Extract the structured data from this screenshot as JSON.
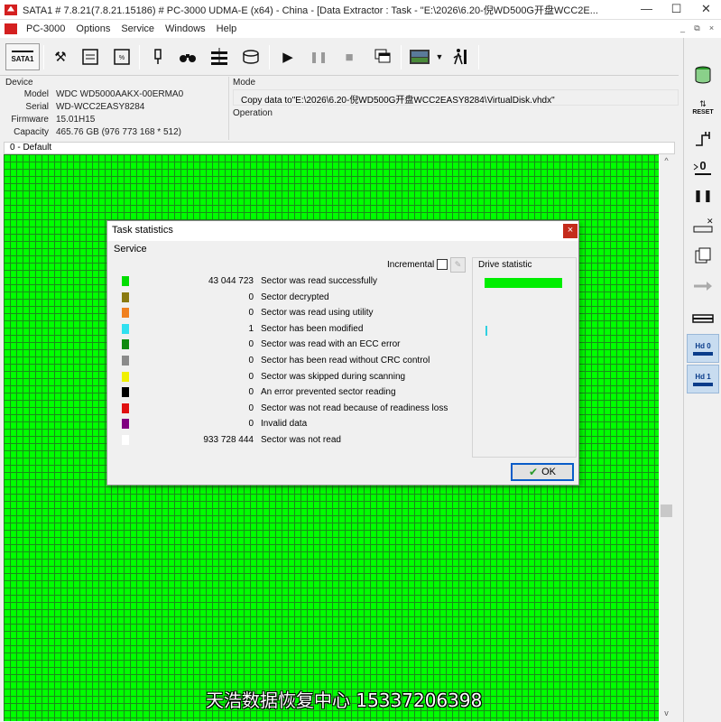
{
  "window": {
    "title": "SATA1 # 7.8.21(7.8.21.15186) # PC-3000 UDMA-E (x64) - China - [Data Extractor : Task - \"E:\\2026\\6.20-倪WD500G开盘WCC2E...",
    "minimize": "—",
    "maximize": "☐",
    "close": "✕"
  },
  "menu": {
    "items": [
      "PC-3000",
      "Options",
      "Service",
      "Windows",
      "Help"
    ],
    "mdi": [
      "_",
      "⧉",
      "×"
    ]
  },
  "toolbar": {
    "sata_label": "SATA1"
  },
  "device": {
    "header": "Device",
    "fields": [
      {
        "key": "Model",
        "value": "WDC WD5000AAKX-00ERMA0"
      },
      {
        "key": "Serial",
        "value": "WD-WCC2EASY8284"
      },
      {
        "key": "Firmware",
        "value": "15.01H15"
      },
      {
        "key": "Capacity",
        "value": "465.76 GB (976 773 168 * 512)"
      }
    ]
  },
  "mode": {
    "header": "Mode",
    "text": "Copy data to\"E:\\2026\\6.20-倪WD500G开盘WCC2EASY8284\\VirtualDisk.vhdx\""
  },
  "operation": {
    "header": "Operation"
  },
  "map": {
    "tab_label": "0 - Default",
    "scroll_up": "^",
    "scroll_down": "v"
  },
  "right_toolbar": {
    "reset_label": "RESET",
    "hd0_label": "Hd 0",
    "hd1_label": "Hd 1"
  },
  "dialog": {
    "title": "Task statistics",
    "close": "×",
    "service_label": "Service",
    "incremental_label": "Incremental",
    "drive_statistic_label": "Drive statistic",
    "ok_label": "OK",
    "stats": [
      {
        "color": "#00dd00",
        "count": "43 044 723",
        "label": "Sector was read successfully"
      },
      {
        "color": "#8a7a10",
        "count": "0",
        "label": "Sector decrypted"
      },
      {
        "color": "#f08020",
        "count": "0",
        "label": "Sector was read using utility"
      },
      {
        "color": "#30e0f0",
        "count": "1",
        "label": "Sector has been modified"
      },
      {
        "color": "#108a10",
        "count": "0",
        "label": "Sector was read with an ECC error"
      },
      {
        "color": "#8a8a8a",
        "count": "0",
        "label": "Sector has been read without CRC control"
      },
      {
        "color": "#f0f000",
        "count": "0",
        "label": "Sector was skipped during scanning"
      },
      {
        "color": "#000000",
        "count": "0",
        "label": "An error prevented sector reading"
      },
      {
        "color": "#e01010",
        "count": "0",
        "label": "Sector was not read because of readiness loss"
      },
      {
        "color": "#800080",
        "count": "0",
        "label": "Invalid data"
      },
      {
        "color": "#ffffff",
        "count": "933 728 444",
        "label": "Sector was not read"
      }
    ],
    "drive_bar_color": "#00ee00",
    "drive_mark_color": "#30d0e0"
  },
  "watermark": "天浩数据恢复中心 15337206398"
}
